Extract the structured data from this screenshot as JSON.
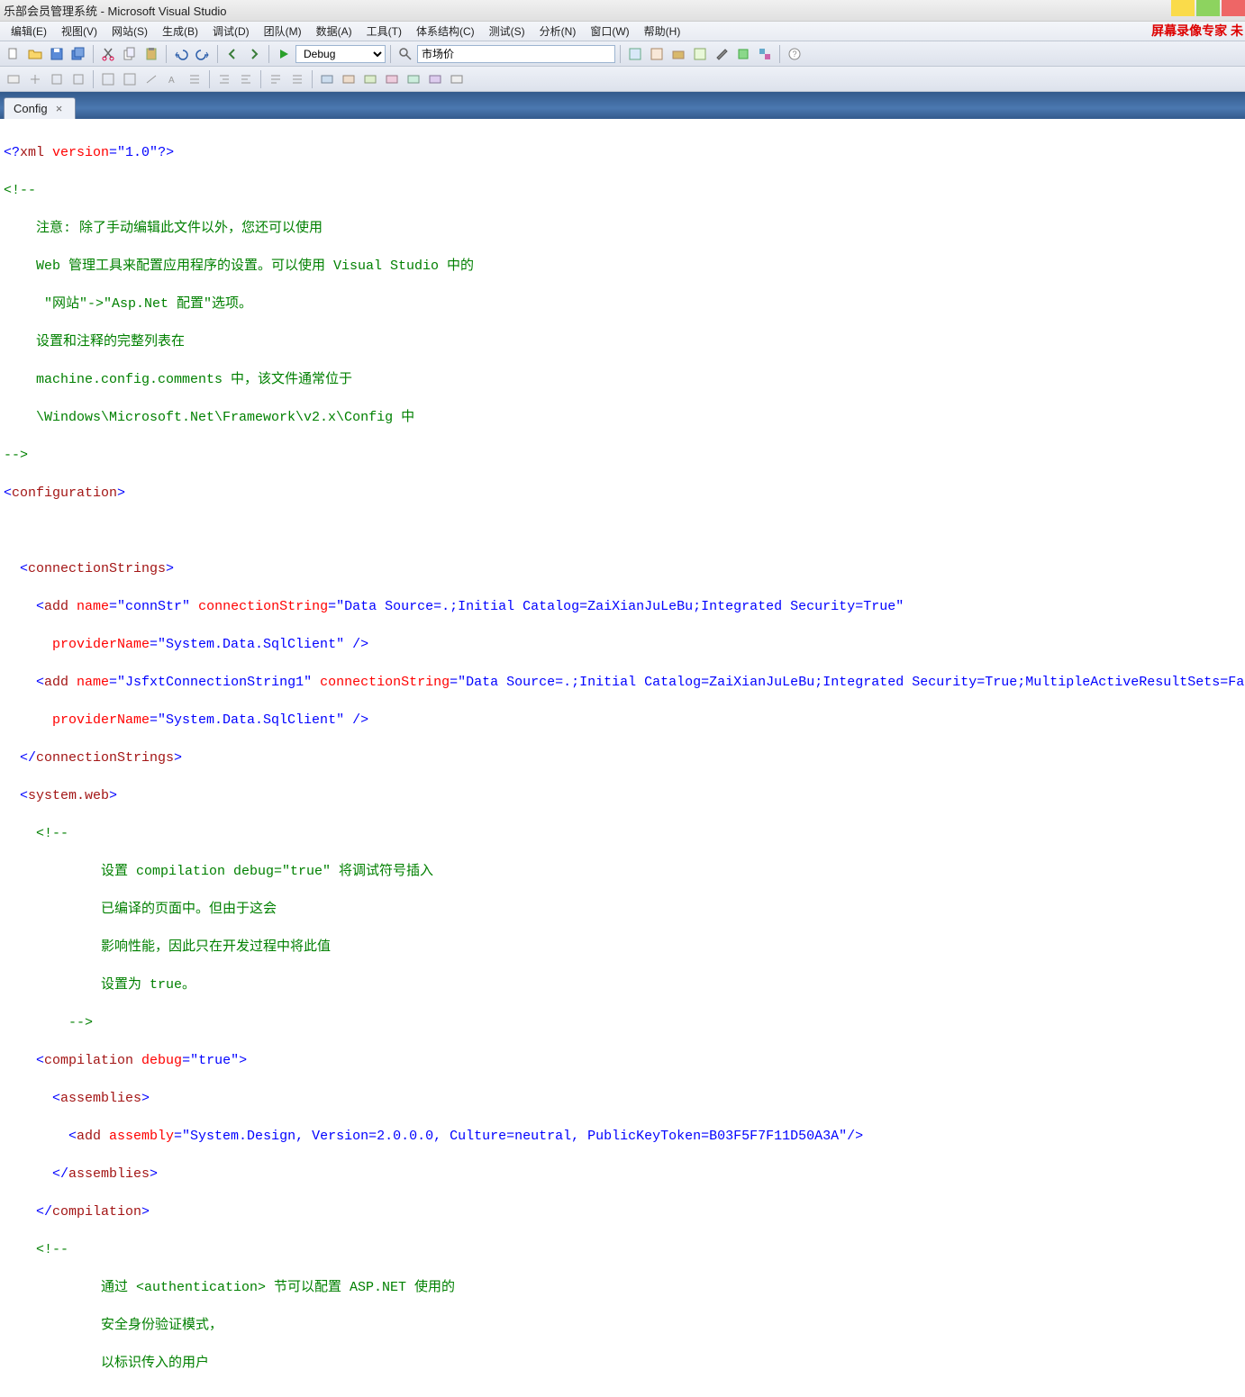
{
  "title": "乐部会员管理系统 - Microsoft Visual Studio",
  "watermark": "屏幕录像专家 未",
  "menu": {
    "items": [
      "编辑(E)",
      "视图(V)",
      "网站(S)",
      "生成(B)",
      "调试(D)",
      "团队(M)",
      "数据(A)",
      "工具(T)",
      "体系结构(C)",
      "测试(S)",
      "分析(N)",
      "窗口(W)",
      "帮助(H)"
    ]
  },
  "toolbar": {
    "config": "Debug",
    "search": "市场价"
  },
  "tab": {
    "label": "Config"
  },
  "code": {
    "l1_a": "<?",
    "l1_b": "xml",
    "l1_c": " version",
    "l1_d": "=\"1.0\"",
    "l1_e": "?>",
    "l2": "<!--",
    "l3": "    注意: 除了手动编辑此文件以外，您还可以使用 ",
    "l4": "    Web 管理工具来配置应用程序的设置。可以使用 Visual Studio 中的",
    "l5": "     \"网站\"->\"Asp.Net 配置\"选项。",
    "l6": "    设置和注释的完整列表在 ",
    "l7": "    machine.config.comments 中，该文件通常位于 ",
    "l8": "    \\Windows\\Microsoft.Net\\Framework\\v2.x\\Config 中",
    "l9": "-->",
    "l10_a": "<",
    "l10_b": "configuration",
    "l10_c": ">",
    "l12_a": "  <",
    "l12_b": "connectionStrings",
    "l12_c": ">",
    "l13_a": "    <",
    "l13_b": "add",
    "l13_c": " name",
    "l13_d": "=\"connStr\"",
    "l13_e": " connectionString",
    "l13_f": "=\"Data Source=.;Initial Catalog=ZaiXianJuLeBu;Integrated Security=True\"",
    "l14_a": "      providerName",
    "l14_b": "=\"System.Data.SqlClient\"",
    "l14_c": " />",
    "l15_a": "    <",
    "l15_b": "add",
    "l15_c": " name",
    "l15_d": "=\"JsfxtConnectionString1\"",
    "l15_e": " connectionString",
    "l15_f": "=\"Data Source=.;Initial Catalog=ZaiXianJuLeBu;Integrated Security=True;MultipleActiveResultSets=Fa",
    "l16_a": "      providerName",
    "l16_b": "=\"System.Data.SqlClient\"",
    "l16_c": " />",
    "l17_a": "  </",
    "l17_b": "connectionStrings",
    "l17_c": ">",
    "l18_a": "  <",
    "l18_b": "system.web",
    "l18_c": ">",
    "l19": "    <!-- ",
    "l20": "            设置 compilation debug=\"true\" 将调试符号插入",
    "l21": "            已编译的页面中。但由于这会 ",
    "l22": "            影响性能，因此只在开发过程中将此值 ",
    "l23": "            设置为 true。",
    "l24": "        -->",
    "l25_a": "    <",
    "l25_b": "compilation",
    "l25_c": " debug",
    "l25_d": "=\"true\"",
    "l25_e": ">",
    "l26_a": "      <",
    "l26_b": "assemblies",
    "l26_c": ">",
    "l27_a": "        <",
    "l27_b": "add",
    "l27_c": " assembly",
    "l27_d": "=\"System.Design, Version=2.0.0.0, Culture=neutral, PublicKeyToken=B03F5F7F11D50A3A\"",
    "l27_e": "/>",
    "l28_a": "      </",
    "l28_b": "assemblies",
    "l28_c": ">",
    "l29_a": "    </",
    "l29_b": "compilation",
    "l29_c": ">",
    "l30": "    <!--",
    "l31": "            通过 <authentication> 节可以配置 ASP.NET 使用的 ",
    "l32": "            安全身份验证模式，",
    "l33": "            以标识传入的用户"
  }
}
